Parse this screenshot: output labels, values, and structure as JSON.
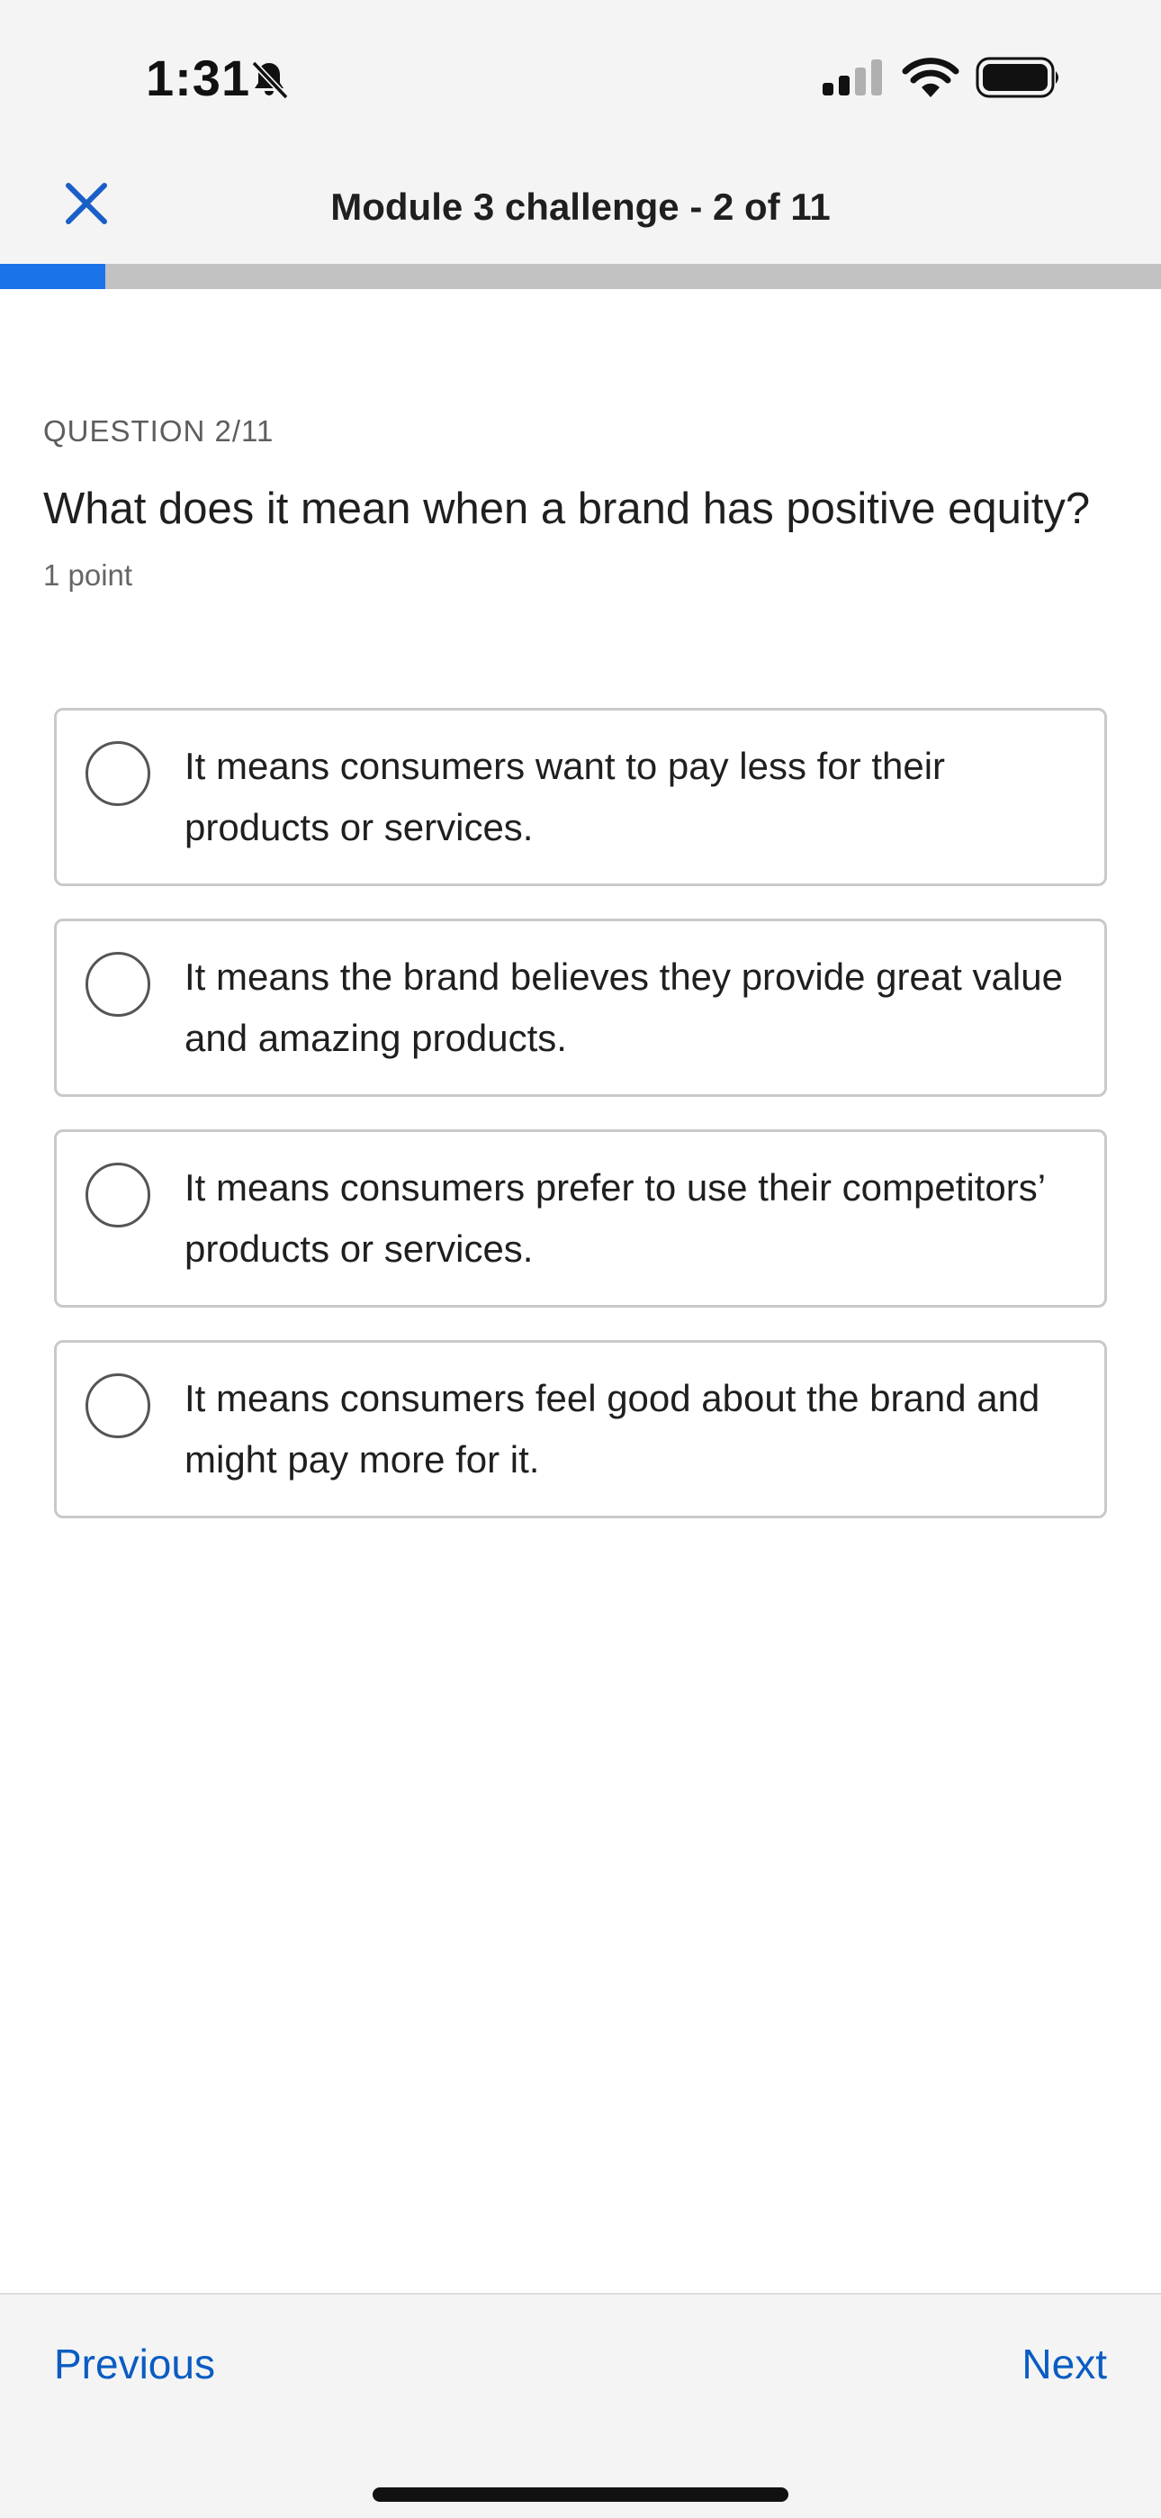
{
  "status_bar": {
    "time": "1:31",
    "icons": [
      "bell-slash-icon",
      "cellular-signal-icon",
      "wifi-icon",
      "battery-icon"
    ]
  },
  "header": {
    "close_icon": "close-icon",
    "title": "Module 3 challenge - 2 of 11"
  },
  "progress": {
    "current": 2,
    "total": 11,
    "fraction": 0.0909,
    "color": "#1a73e8"
  },
  "question": {
    "label": "QUESTION 2/11",
    "text": "What does it mean when a brand has positive equity?",
    "points": "1 point"
  },
  "options": [
    {
      "text": "It means consumers want to pay less for their products or services.",
      "selected": false
    },
    {
      "text": "It means the brand believes they provide great value and amazing products.",
      "selected": false
    },
    {
      "text": "It means consumers prefer to use their competitors’ products or services.",
      "selected": false
    },
    {
      "text": "It means consumers feel good about the brand and might pay more for it.",
      "selected": false
    }
  ],
  "footer": {
    "previous_label": "Previous",
    "next_label": "Next",
    "link_color": "#0a5cc2"
  }
}
